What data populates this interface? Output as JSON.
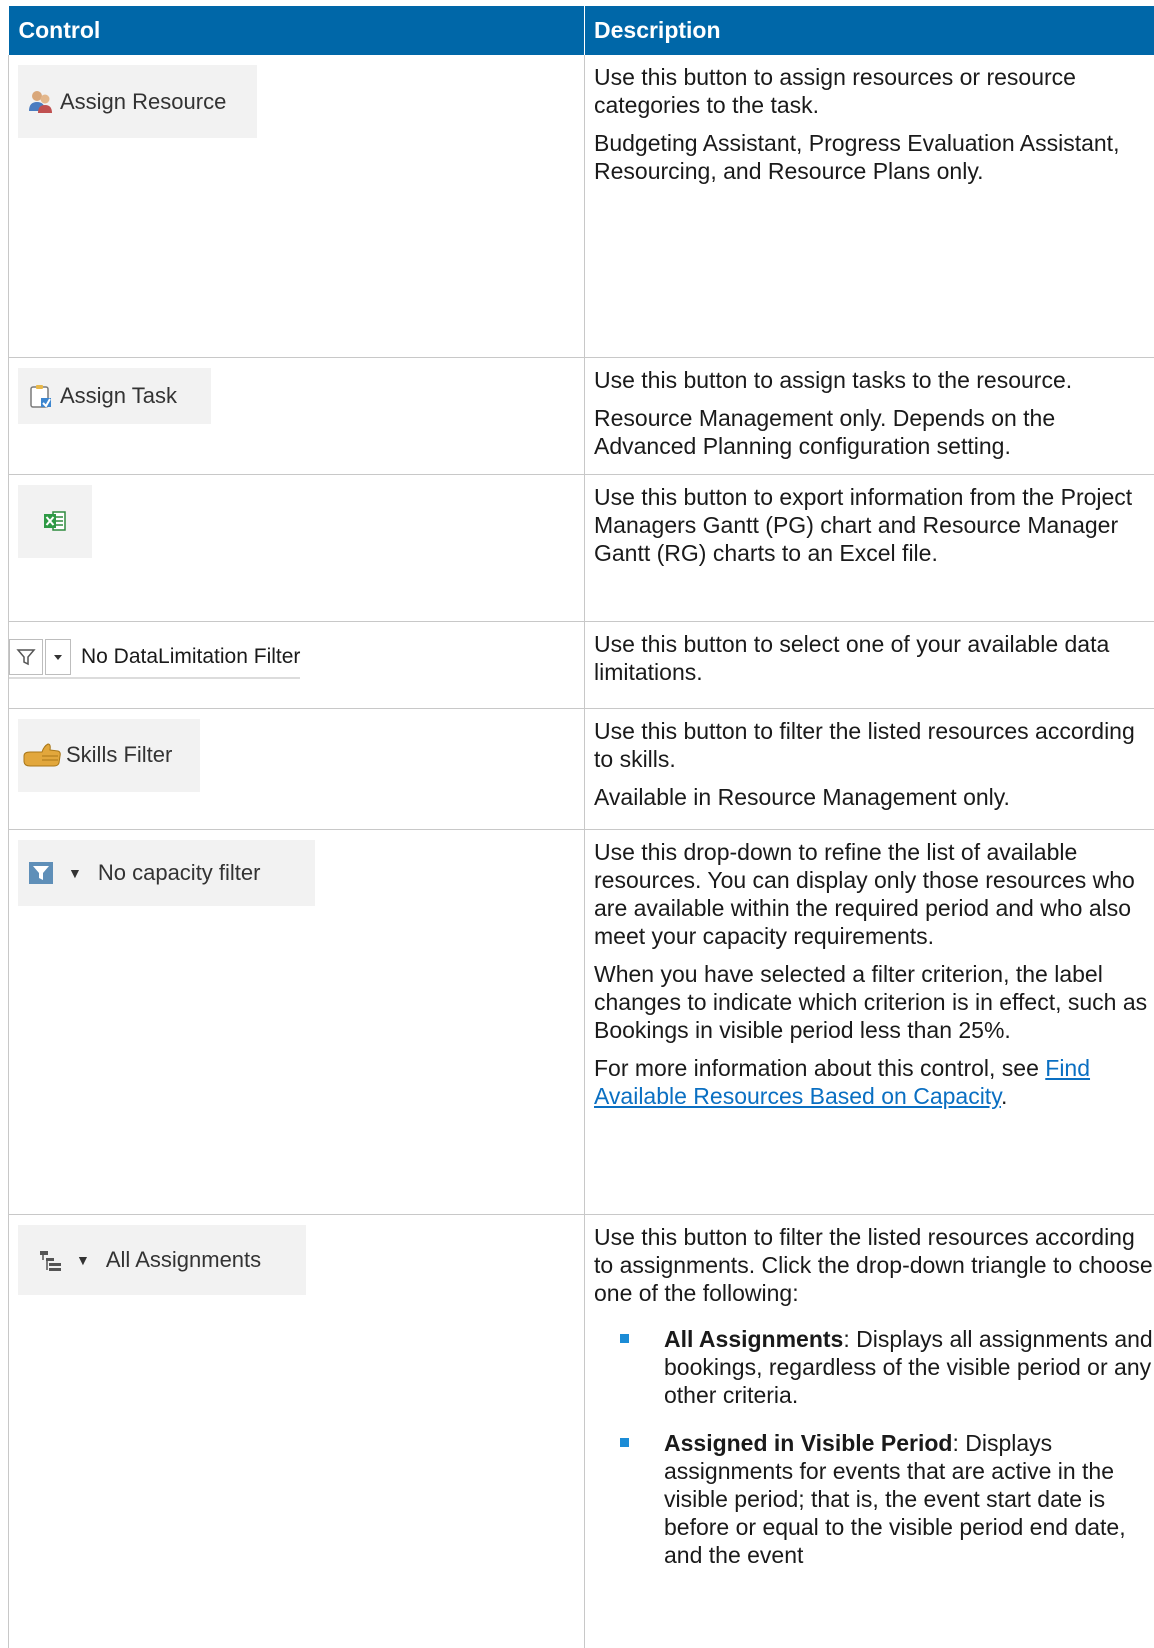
{
  "header": {
    "control": "Control",
    "description": "Description"
  },
  "rows": [
    {
      "control_label": "Assign Resource",
      "icon": "assign-resource-icon",
      "desc": [
        "Use this button to assign resources or resource categories to the task.",
        "Budgeting Assistant, Progress Evaluation Assistant, Resourcing, and Resource Plans only."
      ]
    },
    {
      "control_label": "Assign Task",
      "icon": "assign-task-icon",
      "desc": [
        "Use this button to assign tasks to the resource.",
        "Resource Management only. Depends on the Advanced Planning configuration setting."
      ]
    },
    {
      "control_label": "",
      "icon": "excel-export-icon",
      "desc": [
        "Use this button to export information from the Project Managers Gantt (PG) chart and Resource Manager Gantt (RG) charts to an Excel file."
      ]
    },
    {
      "control_label": "No DataLimitation Filter",
      "icon": "filter-funnel-icon",
      "desc": [
        "Use this button to select one of your available data limitations."
      ]
    },
    {
      "control_label": "Skills Filter",
      "icon": "thumbs-up-icon",
      "desc": [
        "Use this button to filter the listed resources according to skills.",
        "Available in Resource Management only."
      ]
    },
    {
      "control_label": "No capacity filter",
      "icon": "capacity-filter-icon",
      "desc": [
        "Use this drop-down to refine the list of available resources. You can display only those resources who are available within the required period and who also meet your capacity requirements.",
        "When you have selected a filter criterion, the label changes to indicate which criterion is in effect, such as Bookings in visible period less than 25%."
      ],
      "more_prefix": "For more information about this control, see ",
      "more_link": "Find Available Resources Based on Capacity",
      "more_suffix": "."
    },
    {
      "control_label": "All Assignments",
      "icon": "hierarchy-icon",
      "desc": [
        "Use this button to filter the listed resources according to assignments. Click the drop-down triangle to choose one of the following:"
      ],
      "options": [
        {
          "term": "All Assignments",
          "text": ": Displays all assignments and bookings, regardless of the visible period or any other criteria."
        },
        {
          "term": "Assigned in Visible Period",
          "text": ": Displays assignments for events that are active in the visible period; that is, the event start date is before or equal to the visible period end date, and the event"
        }
      ]
    }
  ]
}
